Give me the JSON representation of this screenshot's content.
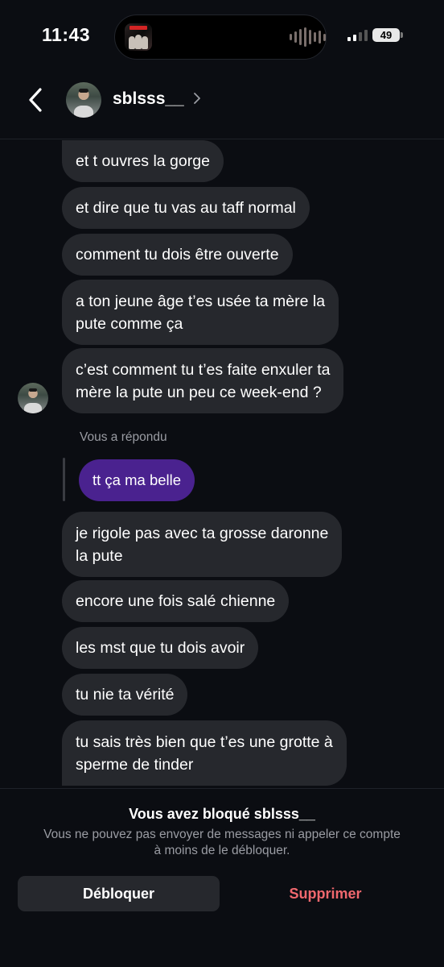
{
  "status_bar": {
    "time": "11:43",
    "battery": "49"
  },
  "header": {
    "username": "sblsss__"
  },
  "messages": [
    "et t ouvres la gorge",
    "et dire que tu vas au taff normal",
    "comment tu dois être ouverte",
    "a ton jeune âge t’es usée ta mère la\npute comme ça",
    "c’est comment tu t’es faite enxuler ta\nmère la pute un peu ce week-end ?",
    "je rigole pas avec ta grosse daronne\nla pute",
    "encore une fois salé chienne",
    "les mst que tu dois avoir",
    "tu nie ta vérité",
    "tu sais très bien que t’es une grotte à\nsperme de tinder"
  ],
  "reply": {
    "label": "Vous a répondu",
    "text": "tt ça ma belle"
  },
  "blocked": {
    "title": "Vous avez bloqué sblsss__",
    "description": "Vous ne pouvez pas envoyer de messages ni appeler ce compte à moins de le débloquer.",
    "unblock_label": "Débloquer",
    "delete_label": "Supprimer"
  },
  "colors": {
    "background": "#0b0d12",
    "incoming_bubble": "#26282d",
    "outgoing_bubble": "#4a228f",
    "delete_text": "#f0686e"
  }
}
